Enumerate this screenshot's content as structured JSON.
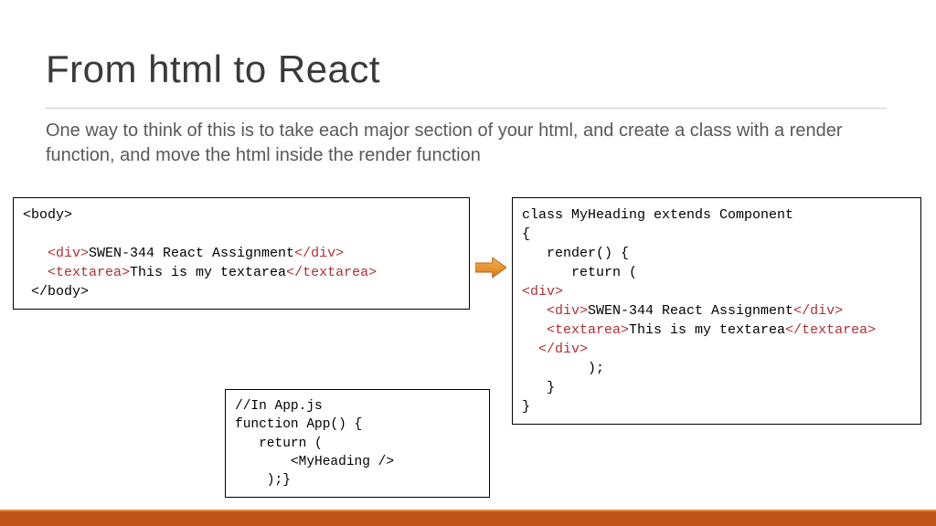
{
  "title": "From html to React",
  "subtitle": "One way to think of this is to take each major section of your html, and create a class with a render function, and move the html inside the render function",
  "left_code": {
    "l1a": "<body>",
    "l2a": "   <div>",
    "l2b": "SWEN-344 React Assignment",
    "l2c": "</div>",
    "l3a": "   <textarea>",
    "l3b": "This is my textarea",
    "l3c": "</textarea>",
    "l4a": " </body>"
  },
  "right_code": {
    "r1": "class MyHeading extends Component",
    "r2": "{",
    "r3": "   render() {",
    "r4": "      return (",
    "r5": "<div>",
    "r6a": "   <div>",
    "r6b": "SWEN-344 React Assignment",
    "r6c": "</div>",
    "r7a": "   <textarea>",
    "r7b": "This is my textarea",
    "r7c": "</textarea>",
    "r8": "  </div>",
    "r9": "        );",
    "r10": "   }",
    "r11": "}"
  },
  "bottom_code": {
    "b1": "//In App.js",
    "b2": "function App() {",
    "b3": "   return (",
    "b4": "       <MyHeading />",
    "b5": "    );}"
  },
  "colors": {
    "accent": "#c0531a",
    "tag": "#b03030"
  }
}
